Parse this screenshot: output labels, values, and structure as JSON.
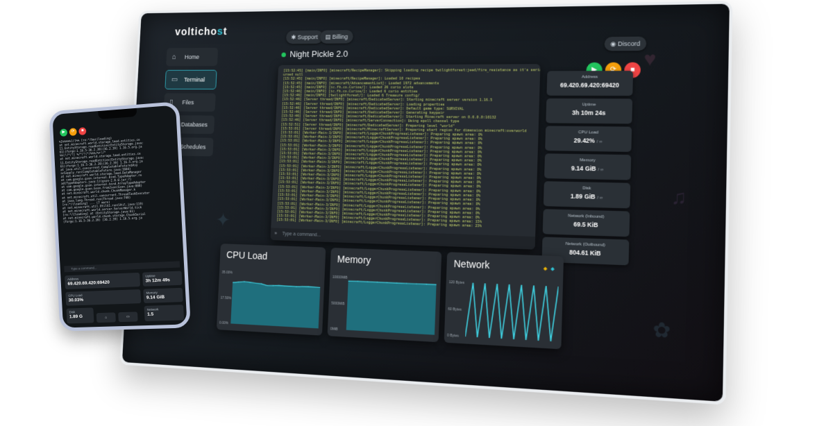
{
  "brand": {
    "logo_text_1": "volticho",
    "logo_accent": "s",
    "logo_text_2": "t",
    "accent_color": "#31c2d4"
  },
  "header": {
    "support_label": "Support",
    "billing_label": "Billing",
    "discord_label": "Discord"
  },
  "sidebar": {
    "items": [
      {
        "label": "Home",
        "icon": "home-icon",
        "active": false
      },
      {
        "label": "Terminal",
        "icon": "terminal-icon",
        "active": true
      },
      {
        "label": "Files",
        "icon": "folder-icon",
        "active": false
      },
      {
        "label": "Databases",
        "icon": "database-icon",
        "active": false
      },
      {
        "label": "Schedules",
        "icon": "clock-icon",
        "active": false
      }
    ]
  },
  "server": {
    "name": "Night Pickle 2.0",
    "status_color": "#22c55e"
  },
  "controls": {
    "start_color": "#22c55e",
    "restart_color": "#f59e0b",
    "stop_color": "#ef4444"
  },
  "console": {
    "lines": [
      "[15:52:45] [main/INFO] [minecraft/RecipeManager]: Skipping loading recipe twilightforest:jeed/fire_resistance as it's serializer ret",
      "urned null",
      "[15:52:45] [main/INFO] [minecraft/RecipeManager]: Loaded 10 recipes",
      "[15:52:45] [main/INFO] [minecraft/AdvancementList]: Loaded 1972 advancements",
      "[15:52:45] [main/INFO] [ic.fh.co.Curios/]: Loaded 26 curio slots",
      "[15:52:46] [main/INFO] [ic.fh.co.Curios/]: Loaded 6 curio entities",
      "[15:52:46] [main/INFO] [twilightforest/]: Loaded 6 Treasure config/",
      "[15:52:46] [Server thread/INFO] [minecraft/DedicatedServer]: Starting minecraft server version 1.16.5",
      "[15:52:46] [Server thread/INFO] [minecraft/DedicatedServer]: Loading properties",
      "[15:52:46] [Server thread/INFO] [minecraft/DedicatedServer]: Default game type: SURVIVAL",
      "[15:52:46] [Server thread/INFO] [minecraft/DedicatedServer]: Generating keypair",
      "[15:52:46] [Server thread/INFO] [minecraft/DedicatedServer]: Starting Minecraft server on 0.0.0.0:10132",
      "[15:52:46] [Server thread/INFO] [minecraft/ServerConnection]: Using epoll channel type",
      "[15:52:51] [Server thread/INFO] [minecraft/DedicatedServer]: Preparing level \"world\"",
      "[15:53:01] [Server thread/INFO] [minecraft/MinecraftServer]: Preparing start region for dimension minecraft:overworld",
      "[15:53:01] [Worker-Main-3/INFO] [minecraft/LoggerChunkProgressListener]: Preparing spawn area: 0%",
      "[15:53:01] [Worker-Main-3/INFO] [minecraft/LoggerChunkProgressListener]: Preparing spawn area: 0%",
      "[15:53:01] [Worker-Main-3/INFO] [minecraft/LoggerChunkProgressListener]: Preparing spawn area: 0%",
      "[15:53:01] [Worker-Main-3/INFO] [minecraft/LoggerChunkProgressListener]: Preparing spawn area: 0%",
      "[15:53:01] [Worker-Main-3/INFO] [minecraft/LoggerChunkProgressListener]: Preparing spawn area: 0%",
      "[15:53:01] [Worker-Main-3/INFO] [minecraft/LoggerChunkProgressListener]: Preparing spawn area: 0%",
      "[15:53:01] [Worker-Main-3/INFO] [minecraft/LoggerChunkProgressListener]: Preparing spawn area: 0%",
      "[15:53:01] [Worker-Main-3/INFO] [minecraft/LoggerChunkProgressListener]: Preparing spawn area: 0%",
      "[15:53:01] [Worker-Main-3/INFO] [minecraft/LoggerChunkProgressListener]: Preparing spawn area: 0%",
      "[15:53:01] [Worker-Main-3/INFO] [minecraft/LoggerChunkProgressListener]: Preparing spawn area: 0%",
      "[15:53:01] [Worker-Main-3/INFO] [minecraft/LoggerChunkProgressListener]: Preparing spawn area: 0%",
      "[15:53:01] [Worker-Main-3/INFO] [minecraft/LoggerChunkProgressListener]: Preparing spawn area: 0%",
      "[15:53:01] [Worker-Main-3/INFO] [minecraft/LoggerChunkProgressListener]: Preparing spawn area: 0%",
      "[15:53:01] [Worker-Main-3/INFO] [minecraft/LoggerChunkProgressListener]: Preparing spawn area: 0%",
      "[15:53:01] [Worker-Main-3/INFO] [minecraft/LoggerChunkProgressListener]: Preparing spawn area: 0%",
      "[15:53:01] [Worker-Main-3/INFO] [minecraft/LoggerChunkProgressListener]: Preparing spawn area: 0%",
      "[15:53:01] [Worker-Main-3/INFO] [minecraft/LoggerChunkProgressListener]: Preparing spawn area: 0%",
      "[15:53:01] [Worker-Main-3/INFO] [minecraft/LoggerChunkProgressListener]: Preparing spawn area: 0%",
      "[15:53:01] [Worker-Main-3/INFO] [minecraft/LoggerChunkProgressListener]: Preparing spawn area: 0%",
      "[15:53:01] [Worker-Main-3/INFO] [minecraft/LoggerChunkProgressListener]: Preparing spawn area: 0%",
      "[15:53:01] [Worker-Main-3/INFO] [minecraft/LoggerChunkProgressListener]: Preparing spawn area: 15%",
      "[15:53:01] [Worker-Main-3/INFO] [minecraft/LoggerChunkProgressListener]: Preparing spawn area: 23%"
    ],
    "input_placeholder": "Type a command..."
  },
  "stats": [
    {
      "label": "Address",
      "value": "69.420.69.420:69420",
      "unit": ""
    },
    {
      "label": "Uptime",
      "value": "3h 10m 24s",
      "unit": ""
    },
    {
      "label": "CPU Load",
      "value": "29.42%",
      "unit": "/ ∞"
    },
    {
      "label": "Memory",
      "value": "9.14 GiB",
      "unit": "/ ∞"
    },
    {
      "label": "Disk",
      "value": "1.89 GiB",
      "unit": "/ ∞"
    },
    {
      "label": "Network (Inbound)",
      "value": "69.5 KiB",
      "unit": ""
    },
    {
      "label": "Network (Outbound)",
      "value": "804.61 KiB",
      "unit": ""
    }
  ],
  "charts_ui": {
    "cpu": {
      "title": "CPU Load",
      "ticks": [
        "35.00%",
        "17.50%",
        "0.00%"
      ]
    },
    "memory": {
      "title": "Memory",
      "ticks": [
        "10000MiB",
        "5000MiB",
        "0MiB"
      ]
    },
    "network": {
      "title": "Network",
      "ticks": [
        "120 Bytes",
        "60 Bytes",
        "0 Bytes"
      ],
      "legend_colors": [
        "#eab308",
        "#31c2d4"
      ]
    }
  },
  "chart_data": [
    {
      "type": "area",
      "title": "CPU Load",
      "ylabel": "",
      "ylim": [
        0,
        35
      ],
      "series": [
        {
          "values": [
            28,
            28.5,
            29,
            28.7,
            28.3,
            28,
            27,
            27.2,
            27.5,
            27.3,
            27.4,
            27.2,
            27.5,
            27.6,
            27.5,
            27.4
          ]
        }
      ]
    },
    {
      "type": "area",
      "title": "Memory",
      "ylabel": "",
      "ylim": [
        0,
        10000
      ],
      "series": [
        {
          "values": [
            9300,
            9310,
            9320,
            9320,
            9330,
            9330,
            9340,
            9340,
            9350,
            9350
          ]
        }
      ]
    },
    {
      "type": "line",
      "title": "Network",
      "ylabel": "",
      "ylim": [
        0,
        120
      ],
      "series": [
        {
          "values": [
            0,
            120,
            0,
            120,
            0,
            120,
            0,
            120,
            0,
            120,
            0,
            120,
            0,
            120,
            0,
            120
          ]
        }
      ]
    }
  ],
  "phone": {
    "console_lines": [
      "%1%%%%%[/]%% [re:*/bac(loading)",
      "at net.minecraft.world.storage.lmod.entities.ce",
      "11.EntityStorage.readEntities(EntityStorage.java:",
      "61)(forge:1.16.5-36.2.39)(36.2.39] 1.16.5.org.ja",
      "%%(!/*/!] %/*/!(*/%%%/%+!/*",
      "at net.minecraft.world.storage.lmod.entities.ce",
      "11.EntityStorage.readEntities(EntityStorage.java:",
      "61)(forge:1.16.5-36.2.39)(36.2.39] 1.16.5.org.ja",
      "at java.util.concurrent.CompletableFuture$Asy",
      "ncSupply.run(CompletableFuture.java:1604)",
      "at net.minecraft.world.storage.lmod.DataManager",
      "at com.google.gson.internal.bind.TypeAdapter.re",
      "ad(TypeAdapters.java:1)(gson-2.8.0.jar:?)",
      "at com.google.gson.internal.bind.ArrayTypeAdapter",
      "at com.google.gson.Gson.fromJson(Gson.java:888)",
      "at net.minecraft.world.chunk.ChunkManager.k",
      "at net.minecraft.util.concurrent.ThreadTaskExecutor",
      "at java.lang.Thread.run(Thread.java:748)",
      "[re:*/(loading] ... (7 more)",
      "at net.minecraft.util.Util$1.run(Util.java:119)",
      "at net.minecraft.world.server.ServerWorld.tick",
      "[re:*/{loading] at (EntityStorage.java:61)",
      "at net.minecraft.world.chunk.storage.ChunkSerial",
      "(forge:1.16.5-36.2.39) [36.2.39] 1.16.5.org.ja"
    ],
    "input_placeholder": "Type a command...",
    "cards": [
      {
        "label": "Address",
        "value": "69.420.69.420:69420"
      },
      {
        "label": "Uptime",
        "value": "3h 12m 49s"
      },
      {
        "label": "CPU Load",
        "value": "30.03%"
      },
      {
        "label": "Memory",
        "value": "9.14 GiB"
      },
      {
        "label": "Disk",
        "value": "1.89 G"
      },
      {
        "label": "Network",
        "value": "1.5"
      }
    ]
  }
}
